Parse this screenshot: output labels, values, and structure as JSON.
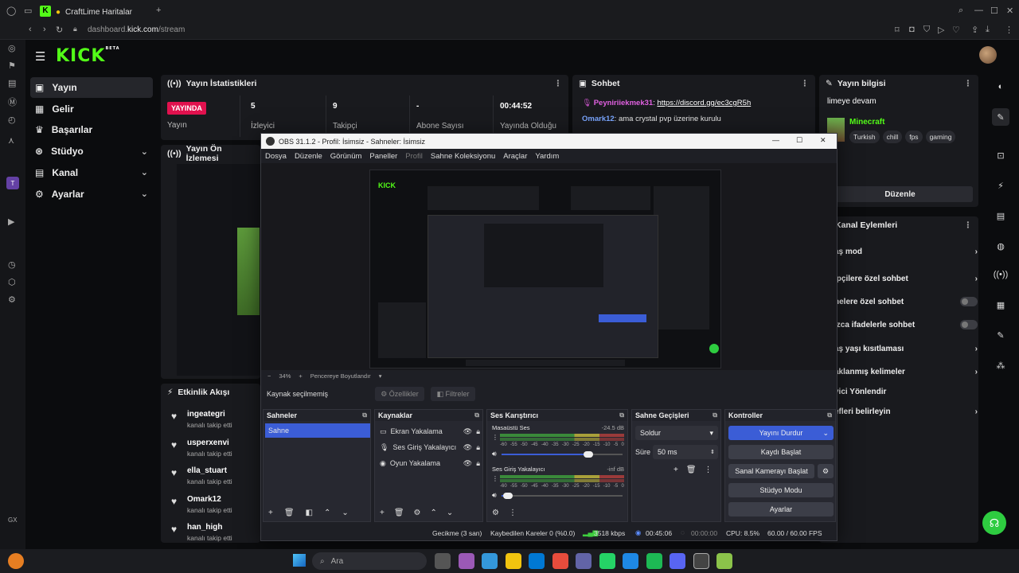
{
  "browser": {
    "tab_title": "CraftLime Haritalar",
    "url_host": "dashboard.",
    "url_domain": "kick.com",
    "url_path": "/stream"
  },
  "kick": {
    "logo": "KICK",
    "logo_badge": "BETA",
    "nav": [
      {
        "label": "Yayın",
        "icon": "broadcast-icon",
        "active": true
      },
      {
        "label": "Gelir",
        "icon": "revenue-icon"
      },
      {
        "label": "Başarılar",
        "icon": "trophy-icon"
      },
      {
        "label": "Stüdyo",
        "icon": "studio-icon",
        "chevron": true
      },
      {
        "label": "Kanal",
        "icon": "channel-icon",
        "chevron": true
      },
      {
        "label": "Ayarlar",
        "icon": "gear-icon",
        "chevron": true
      }
    ],
    "stats": {
      "title": "Yayın İstatistikleri",
      "live_badge": "YAYINDA",
      "live_label": "Yayın",
      "items": [
        {
          "value": "5",
          "label": "İzleyici"
        },
        {
          "value": "9",
          "label": "Takipçi"
        },
        {
          "value": "-",
          "label": "Abone Sayısı"
        },
        {
          "value": "00:44:52",
          "label": "Yayında Olduğu"
        }
      ]
    },
    "chat": {
      "title": "Sohbet",
      "messages": [
        {
          "user": "Peyniriiekmek31",
          "text": "https://discord.gg/ec3cgR5h",
          "color": "#e060e0"
        },
        {
          "user": "Omark12",
          "text": "ama crystal pvp üzerine kurulu",
          "color": "#7aa6ff"
        }
      ]
    },
    "stream_info": {
      "title": "Yayın bilgisi",
      "stream_title": "limeye devam",
      "category": "Minecraft",
      "tags": [
        "Turkish",
        "chill",
        "fps",
        "gaming"
      ],
      "edit_button": "Düzenle"
    },
    "preview": {
      "title": "Yayın Ön İzlemesi"
    },
    "activity": {
      "title": "Etkinlik Akışı",
      "items": [
        {
          "name": "ingeategri",
          "sub": "kanalı takip etti"
        },
        {
          "name": "usperxenvi",
          "sub": "kanalı takip etti"
        },
        {
          "name": "ella_stuart",
          "sub": "kanalı takip etti"
        },
        {
          "name": "Omark12",
          "sub": "kanalı takip etti"
        },
        {
          "name": "han_high",
          "sub": "kanalı takip etti"
        }
      ]
    },
    "channel_actions": {
      "title": "Kanal Eylemleri",
      "items": [
        {
          "label": "aş mod",
          "control": "chevron"
        },
        {
          "label": "ipçilere özel sohbet",
          "control": "chevron"
        },
        {
          "label": "nelere özel sohbet",
          "control": "toggle"
        },
        {
          "label": "ızca ifadelerle sohbet",
          "control": "toggle"
        },
        {
          "label": "aş yaşı kısıtlaması",
          "control": "chevron"
        },
        {
          "label": "aklanmış kelimeler",
          "control": "chevron"
        },
        {
          "label": "yici Yönlendir",
          "control": "none"
        },
        {
          "label": "efleri belirleyin",
          "control": "chevron"
        }
      ]
    }
  },
  "obs": {
    "title": "OBS 31.1.2 - Profil: İsimsiz - Sahneler: İsimsiz",
    "menu": [
      "Dosya",
      "Düzenle",
      "Görünüm",
      "Paneller",
      "Profil",
      "Sahne Koleksiyonu",
      "Araçlar",
      "Yardım"
    ],
    "zoom": "34%",
    "zoom_mode": "Pencereye Boyutlandır",
    "no_source": "Kaynak seçilmemiş",
    "properties": "Özellikler",
    "filters": "Filtreler",
    "scenes": {
      "title": "Sahneler",
      "items": [
        "Sahne"
      ]
    },
    "sources": {
      "title": "Kaynaklar",
      "items": [
        "Ekran Yakalama",
        "Ses Giriş Yakalayıcısı",
        "Oyun Yakalama"
      ]
    },
    "mixer": {
      "title": "Ses Karıştırıcı",
      "channels": [
        {
          "name": "Masaüstü Ses",
          "db": "-24.5 dB",
          "level": 0.72
        },
        {
          "name": "Ses Giriş Yakalayıcı",
          "db": "-inf dB",
          "level": 0.05
        }
      ],
      "scale": [
        "-60",
        "-55",
        "-50",
        "-45",
        "-40",
        "-35",
        "-30",
        "-25",
        "-20",
        "-15",
        "-10",
        "-5",
        "0"
      ]
    },
    "transitions": {
      "title": "Sahne Geçişleri",
      "type": "Soldur",
      "duration_label": "Süre",
      "duration": "50 ms"
    },
    "controls": {
      "title": "Kontroller",
      "buttons": [
        "Yayını Durdur",
        "Kaydı Başlat",
        "Sanal Kamerayı Başlat",
        "Stüdyo Modu",
        "Ayarlar"
      ]
    },
    "status": {
      "delay": "Gecikme (3 san)",
      "dropped": "Kaybedilen Kareler 0 (%0.0)",
      "bitrate": "3518 kbps",
      "stream_time": "00:45:06",
      "rec_time": "00:00:00",
      "cpu": "CPU: 8.5%",
      "fps": "60.00 / 60.00 FPS"
    }
  },
  "taskbar": {
    "search_placeholder": "Ara",
    "side_label": "GX"
  },
  "colors": {
    "kick_green": "#53fc18",
    "live_red": "#e1114e",
    "obs_accent": "#3b5dd6"
  }
}
